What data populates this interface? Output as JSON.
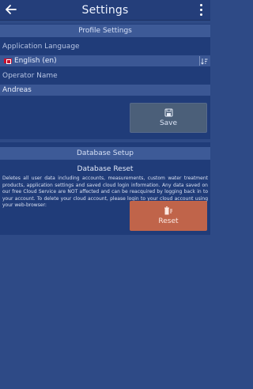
{
  "header": {
    "title": "Settings"
  },
  "profile": {
    "section_title": "Profile Settings",
    "language_label": "Application Language",
    "language_value": "English (en)",
    "operator_label": "Operator Name",
    "operator_value": "Andreas",
    "save_label": "Save"
  },
  "database": {
    "section_title": "Database Setup",
    "reset_title": "Database Reset",
    "reset_description": "Deletes all user data including accounts, measurements, custom water treatment products, application settings and saved cloud login information. Any data saved on our free Cloud Service are NOT affected and can be reacquired by logging back in to your account. To delete your cloud account, please login to your cloud account using your web-browser:",
    "reset_label": "Reset"
  },
  "colors": {
    "background": "#2e4a86",
    "panel": "#203c79",
    "section_header": "#3d5a97",
    "reset_button": "#c0644a",
    "save_button": "#4b5f79"
  }
}
